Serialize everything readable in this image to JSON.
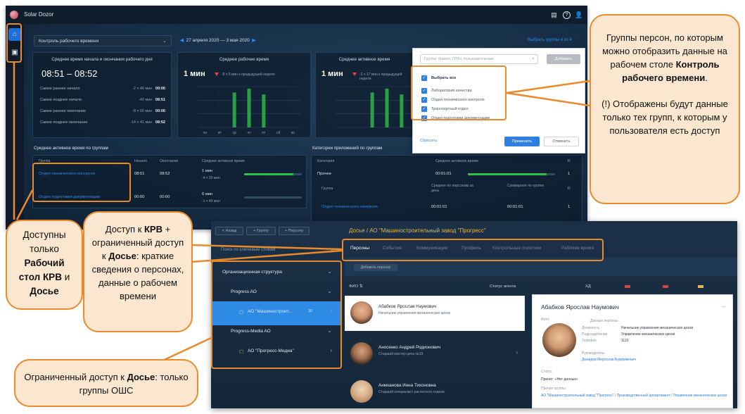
{
  "dashboard": {
    "app_title": "Solar Dozor",
    "work_time_dropdown": "Контроль рабочего времени",
    "date_range": "27 апреля 2020 — 3 мая 2020",
    "filter_link": "Выбрать группы 4 из 4",
    "card1": {
      "title": "Среднее время начала и окончания рабочего дня",
      "big": "08:51 – 08:52",
      "rows": [
        {
          "label": "Самое раннее начало",
          "delta": "-2 ч 46 мин",
          "value": "00:00"
        },
        {
          "label": "Самое позднее начало",
          "delta": "-40 мин",
          "value": "08:51"
        },
        {
          "label": "Самое раннее окончание",
          "delta": "-8 ч 56 мин",
          "value": "00:00"
        },
        {
          "label": "Самое позднее окончание",
          "delta": "-14 ч 41 мин",
          "value": "08:52"
        }
      ]
    },
    "card2": {
      "title": "Среднее рабочее время",
      "big": "1 мин",
      "compare": "-8 ч 5 мин к предыдущей неделе",
      "days": [
        "пн",
        "вт",
        "ср",
        "чт",
        "пт",
        "сб",
        "вс"
      ],
      "values": [
        0,
        0,
        0.9,
        1,
        0.85,
        0,
        0
      ]
    },
    "card3": {
      "title": "Среднее активное время",
      "big": "1 мин",
      "compare": "-3 ч 17 мин к предыдущей неделе"
    },
    "groups_section": {
      "title": "Среднее активное время по группам",
      "headers": [
        "Группа",
        "Начало",
        "Окончание",
        "Среднее активное время"
      ],
      "rows": [
        {
          "group": "Отдел технического контроля",
          "start": "08:51",
          "end": "08:52",
          "active": "1 мин",
          "delta": "-4 ч 20 мин",
          "fill": 0.85
        },
        {
          "group": "Отдел подготовки документации",
          "start": "00:00",
          "end": "00:00",
          "active": "0 мин",
          "delta": "-1 ч 45 мин",
          "fill": 0
        }
      ]
    },
    "apps_section": {
      "title": "Категории приложений по группам",
      "headers": [
        "Категория",
        "Среднее активное время",
        "R"
      ],
      "row1": {
        "cat": "Прочее",
        "time": "00:01:01",
        "r": "1",
        "fill": 0.9
      },
      "sub_headers": [
        "Группа",
        "Среднее по персонам за день",
        "Суммарное по группе",
        "R"
      ],
      "row2": {
        "group": "Отдел технического контроля",
        "avg": "00:01:01",
        "sum": "00:01:01",
        "r": "1"
      }
    },
    "popup": {
      "search_placeholder": "Группы: фамил, ГРЛН, пользовательские",
      "add": "Добавить",
      "select_all": "Выбрать все",
      "items": [
        "Лаборатория качества",
        "Отдел технического контроля",
        "Транспортный отдел",
        "Отдел подготовки документации"
      ],
      "reset": "Сбросить",
      "apply": "Применить",
      "cancel": "Отменить"
    }
  },
  "dossier": {
    "buttons": [
      "< Назад",
      "+ Группу",
      "+ Персону"
    ],
    "title": "Досье / АО \"Машиностроительный завод \"Прогресс\"",
    "tabs": [
      "Персоны",
      "События",
      "Коммуникации",
      "Профиль",
      "Контрольные политики",
      "Рабочее время"
    ],
    "search_label": "Поиск по ключевым словам",
    "add_person": "Добавить персону",
    "tree": [
      {
        "label": "Организационная структура",
        "chev": "⌄"
      },
      {
        "label": "Progress AO",
        "chev": "⌄"
      },
      {
        "label": "АО \"Машиностроит...",
        "chev": "›",
        "count": "30"
      },
      {
        "label": "Progress-Media AO",
        "chev": "⌄"
      },
      {
        "label": "АО \"Прогресс-Медиа\"",
        "chev": "›"
      }
    ],
    "col_fio": "ФИО",
    "col_status": "Статус агента",
    "col_hd": "ХД",
    "persons": [
      {
        "name": "Абабков Ярослав Наумович",
        "role": "Начальник управления механических цехов"
      },
      {
        "name": "Аносенко Андрей Родионович",
        "role": "Старший мастер цеха №19"
      },
      {
        "name": "Анмханова Инна Тихоновна",
        "role": "Старший специалист расчетного отдела"
      }
    ],
    "detail": {
      "name": "Абабков Ярослав Наумович",
      "photo_label": "Фото",
      "personal_data": "Данные персоны",
      "fields": [
        {
          "label": "Должность",
          "value": "Начальник управления механических цехов"
        },
        {
          "label": "Подразделение",
          "value": "Управление механических цехов"
        },
        {
          "label": "Телефон",
          "value": "1110"
        }
      ],
      "manager_label": "Руководитель",
      "manager": "Демидов Мирослав Бумфимович",
      "status_label": "Статус",
      "status": "Принят: «Нет данных»",
      "groups_label": "Прочие группы",
      "groups": "АО \"Машиностроительный завод \"Прогресс\" / Производственный департамент / Управление механических цехов"
    }
  },
  "callouts": {
    "top_right": {
      "line1": "Группы персон, по которым можно отобразить данные на рабочем столе ",
      "bold": "Контроль рабочего времени",
      "after": ".",
      "note": "(!) Отображены будут данные только тех групп, к которым у пользователя есть доступ"
    },
    "left": {
      "t1": "Доступны только ",
      "b1": "Рабочий стол КРВ",
      "t2": " и ",
      "b2": "Досье"
    },
    "middle": {
      "t1": "Доступ к ",
      "b1": "КРВ",
      "t2": " + ограниченный доступ к ",
      "b2": "Досье",
      "t3": ": краткие сведения о персонах, данные о рабочем времени"
    },
    "bottom": {
      "t1": "Ограниченный доступ к ",
      "b1": "Досье",
      "t2": ": только группы ОШС"
    }
  },
  "colors": {
    "accent": "#e98b2a",
    "callout_fill": "#fbe7d0",
    "link": "#2e8be6",
    "primary": "#2f7fe0"
  }
}
